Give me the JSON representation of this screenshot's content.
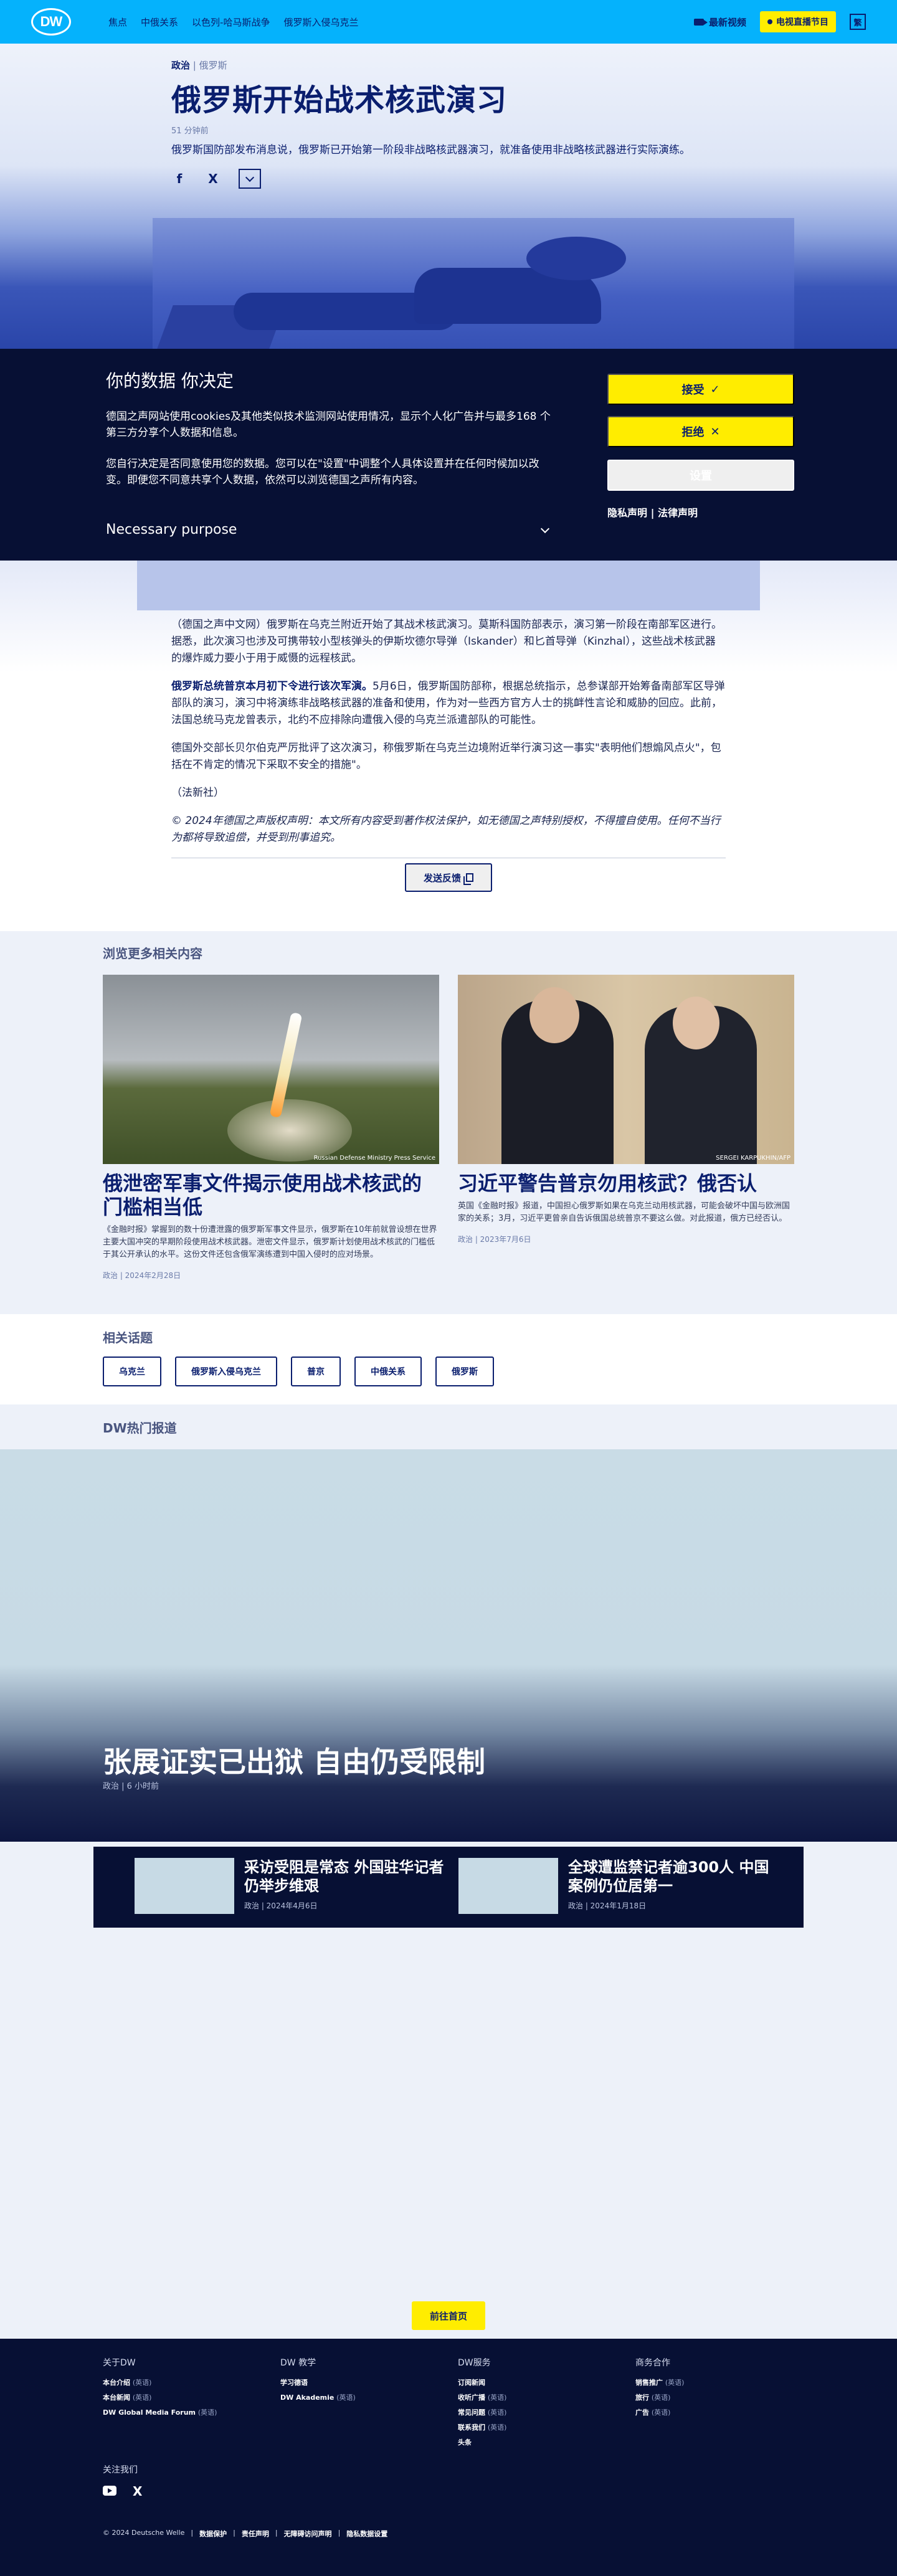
{
  "nav": {
    "logo": "DW",
    "items": [
      "焦点",
      "中俄关系",
      "以色列-哈马斯战争",
      "俄罗斯入侵乌克兰"
    ],
    "video": "最新视频",
    "tv": "电视直播节目",
    "lang": "繁"
  },
  "article": {
    "kicker_category": "政治",
    "kicker_sep": "|",
    "kicker_topic": "俄罗斯",
    "title": "俄罗斯开始战术核武演习",
    "time_ago": "51 分钟前",
    "lead": "俄罗斯国防部发布消息说，俄罗斯已开始第一阶段非战略核武器演习，就准备使用非战略核武器进行实际演练。",
    "share": {
      "facebook": "f",
      "x": "X"
    },
    "paragraphs": [
      "（德国之声中文网）俄罗斯在乌克兰附近开始了其战术核武演习。莫斯科国防部表示，演习第一阶段在南部军区进行。据悉，此次演习也涉及可携带较小型核弹头的伊斯坎德尔导弹（Iskander）和匕首导弹（Kinzhal），这些战术核武器的爆炸威力要小于用于威慑的远程核武。",
      "德国外交部长贝尔伯克严厉批评了这次演习，称俄罗斯在乌克兰边境附近举行演习这一事实\"表明他们想煽风点火\"，包括在不肯定的情况下采取不安全的措施\"。",
      "（法新社）"
    ],
    "bold_lead": "俄罗斯总统普京本月初下令进行该次军演。",
    "bold_para_rest": "5月6日，俄罗斯国防部称，根据总统指示，总参谋部开始筹备南部军区导弹部队的演习，演习中将演练非战略核武器的准备和使用，作为对一些西方官方人士的挑衅性言论和威胁的回应。此前，法国总统马克龙曾表示，北约不应排除向遭俄入侵的乌克兰派遣部队的可能性。",
    "copyright": "© 2024年德国之声版权声明：本文所有内容受到著作权法保护，如无德国之声特别授权，不得擅自使用。任何不当行为都将导致追偿，并受到刑事追究。",
    "feedback": "发送反馈"
  },
  "cookie": {
    "title": "你的数据 你决定",
    "p1": "德国之声网站使用cookies及其他类似技术监测网站使用情况，显示个人化广告并与最多168 个第三方分享个人数据和信息。",
    "p2": "您自行决定是否同意使用您的数据。您可以在\"设置\"中调整个人具体设置并在任何时候加以改变。即便您不同意共享个人数据，依然可以浏览德国之声所有内容。",
    "purpose": "Necessary purpose",
    "accept": "接受",
    "reject": "拒绝",
    "settings": "设置",
    "privacy": "隐私声明",
    "sep": "|",
    "legal": "法律声明"
  },
  "related": {
    "title": "浏览更多相关内容",
    "cards": [
      {
        "headline": "俄泄密军事文件揭示使用战术核武的门槛相当低",
        "summary": "《金融时报》掌握到的数十份遭泄露的俄罗斯军事文件显示，俄罗斯在10年前就曾设想在世界主要大国冲突的早期阶段使用战术核武器。泄密文件显示，俄罗斯计划使用战术核武的门槛低于其公开承认的水平。这份文件还包含俄军演练遭到中国入侵时的应对场景。",
        "meta": "政治 | 2024年2月28日",
        "credit": "Russian Defense Ministry Press Service"
      },
      {
        "headline": "习近平警告普京勿用核武？俄否认",
        "summary": "英国《金融时报》报道，中国担心俄罗斯如果在乌克兰动用核武器，可能会破坏中国与欧洲国家的关系；3月，习近平更曾亲自告诉俄国总统普京不要这么做。对此报道，俄方已经否认。",
        "meta": "政治 | 2023年7月6日",
        "credit": "SERGEI KARPUKHIN/AFP"
      }
    ]
  },
  "topics": {
    "title": "相关话题",
    "tags": [
      "乌克兰",
      "俄罗斯入侵乌克兰",
      "普京",
      "中俄关系",
      "俄罗斯"
    ]
  },
  "hot": {
    "title": "DW热门报道",
    "main_headline": "张展证实已出狱 自由仍受限制",
    "main_meta": "政治 | 6 小时前",
    "minis": [
      {
        "headline": "采访受阻是常态 外国驻华记者仍举步维艰",
        "meta": "政治 | 2024年4月6日"
      },
      {
        "headline": "全球遭监禁记者逾300人 中国案例仍位居第一",
        "meta": "政治 | 2024年1月18日"
      }
    ],
    "goto": "前往首页"
  },
  "footer": {
    "cols": [
      {
        "title": "关于DW",
        "items": [
          [
            "本台介绍",
            "(英语)"
          ],
          [
            "本台新闻",
            "(英语)"
          ],
          [
            "DW Global Media Forum",
            "(英语)"
          ]
        ]
      },
      {
        "title": "DW 教学",
        "items": [
          [
            "学习德语",
            ""
          ],
          [
            "DW Akademie",
            "(英语)"
          ]
        ]
      },
      {
        "title": "DW服务",
        "items": [
          [
            "订阅新闻",
            ""
          ],
          [
            "收听广播",
            "(英语)"
          ],
          [
            "常见问题",
            "(英语)"
          ],
          [
            "联系我们",
            "(英语)"
          ],
          [
            "头条",
            ""
          ]
        ]
      },
      {
        "title": "商务合作",
        "items": [
          [
            "销售推广",
            "(英语)"
          ],
          [
            "旅行",
            "(英语)"
          ],
          [
            "广告",
            "(英语)"
          ]
        ]
      }
    ],
    "follow": "关注我们",
    "legal": [
      "© 2024 Deutsche Welle",
      "数据保护",
      "责任声明",
      "无障碍访问声明",
      "隐私数据设置"
    ],
    "legal_sep": "|"
  }
}
